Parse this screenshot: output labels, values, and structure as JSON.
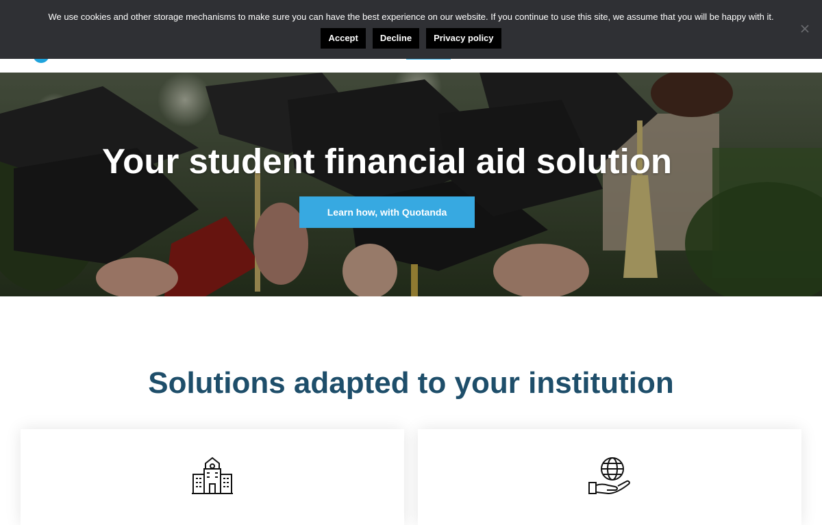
{
  "cookie_banner": {
    "message": "We use cookies and other storage mechanisms to make sure you can have the best experience on our website. If you continue to use this site, we assume that you will be happy with it.",
    "accept_label": "Accept",
    "decline_label": "Decline",
    "privacy_label": "Privacy policy",
    "close_icon": "close-icon"
  },
  "hero": {
    "title": "Your student financial aid solution",
    "cta_label": "Learn how, with Quotanda",
    "cta_color": "#37a9e1"
  },
  "solutions": {
    "title": "Solutions adapted to your institution",
    "title_color": "#1e4e6a",
    "cards": [
      {
        "icon": "school-building-icon"
      },
      {
        "icon": "globe-in-hand-icon"
      }
    ]
  }
}
